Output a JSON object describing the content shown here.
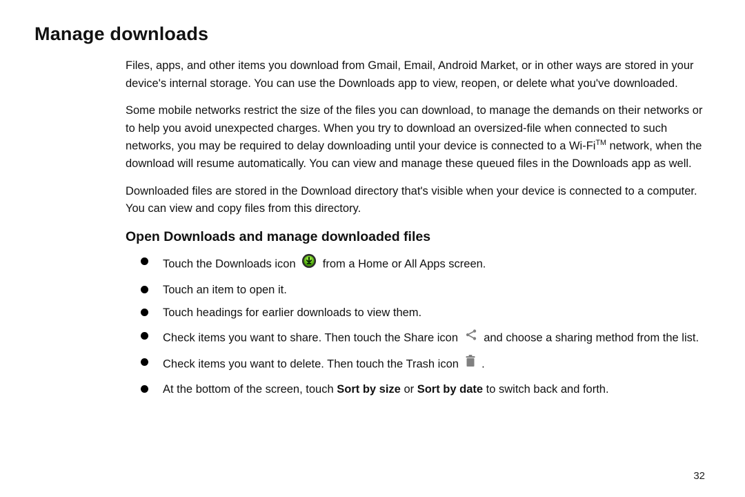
{
  "title": "Manage downloads",
  "paragraphs": {
    "p1": "Files, apps, and other items you download from Gmail, Email, Android Market, or in other ways are stored in your device's internal storage. You can use the Downloads app to view, reopen, or delete what you've downloaded.",
    "p2_a": "Some mobile networks restrict the size of the files you can download, to manage the demands on their networks or to help you avoid unexpected charges. When you try to download an oversized-file when connected to such networks, you may be required to delay downloading until your device is connected to a Wi-Fi",
    "p2_sup": "TM",
    "p2_b": " network, when the download will resume automatically. You can view and manage these queued files in the Downloads app as well.",
    "p3": "Downloaded files are stored in the Download directory that's visible when your device is connected to a computer. You can view and copy files from this directory."
  },
  "subhead": "Open Downloads and manage downloaded files",
  "bullets": {
    "b1_a": "Touch the Downloads icon ",
    "b1_b": " from a Home or All Apps screen.",
    "b2": "Touch an item to open it.",
    "b3": "Touch headings for earlier downloads to view them.",
    "b4_a": "Check items you want to share. Then touch the Share icon ",
    "b4_b": " and choose a sharing method from the list.",
    "b5_a": "Check items you want to delete. Then touch the Trash icon ",
    "b5_b": " .",
    "b6_a": "At the bottom of the screen, touch ",
    "b6_bold1": "Sort by size",
    "b6_mid": " or ",
    "b6_bold2": "Sort by date",
    "b6_b": " to switch back and forth."
  },
  "page_number": "32"
}
